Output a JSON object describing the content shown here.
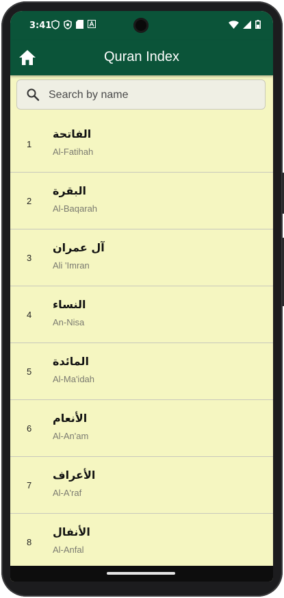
{
  "status_bar": {
    "time": "3:41",
    "left_icons": [
      "shield-outline-icon",
      "vpn-shield-icon",
      "sd-card-icon",
      "font-icon"
    ],
    "right_icons": [
      "wifi-icon",
      "signal-icon",
      "battery-icon"
    ]
  },
  "app_bar": {
    "title": "Quran Index",
    "home_icon": "home-icon",
    "color": "#0b5439"
  },
  "search": {
    "placeholder": "Search by name",
    "value": ""
  },
  "surahs": [
    {
      "number": "1",
      "arabic": "الفاتحة",
      "english": "Al-Fatihah"
    },
    {
      "number": "2",
      "arabic": "البقرة",
      "english": "Al-Baqarah"
    },
    {
      "number": "3",
      "arabic": "آل عمران",
      "english": "Ali 'Imran"
    },
    {
      "number": "4",
      "arabic": "النساء",
      "english": "An-Nisa"
    },
    {
      "number": "5",
      "arabic": "المائدة",
      "english": "Al-Ma'idah"
    },
    {
      "number": "6",
      "arabic": "الأنعام",
      "english": "Al-An'am"
    },
    {
      "number": "7",
      "arabic": "الأعراف",
      "english": "Al-A'raf"
    },
    {
      "number": "8",
      "arabic": "الأنفال",
      "english": "Al-Anfal"
    }
  ],
  "colors": {
    "background": "#f5f6c1",
    "primary": "#0b5439",
    "divider": "#c8c8bc"
  }
}
